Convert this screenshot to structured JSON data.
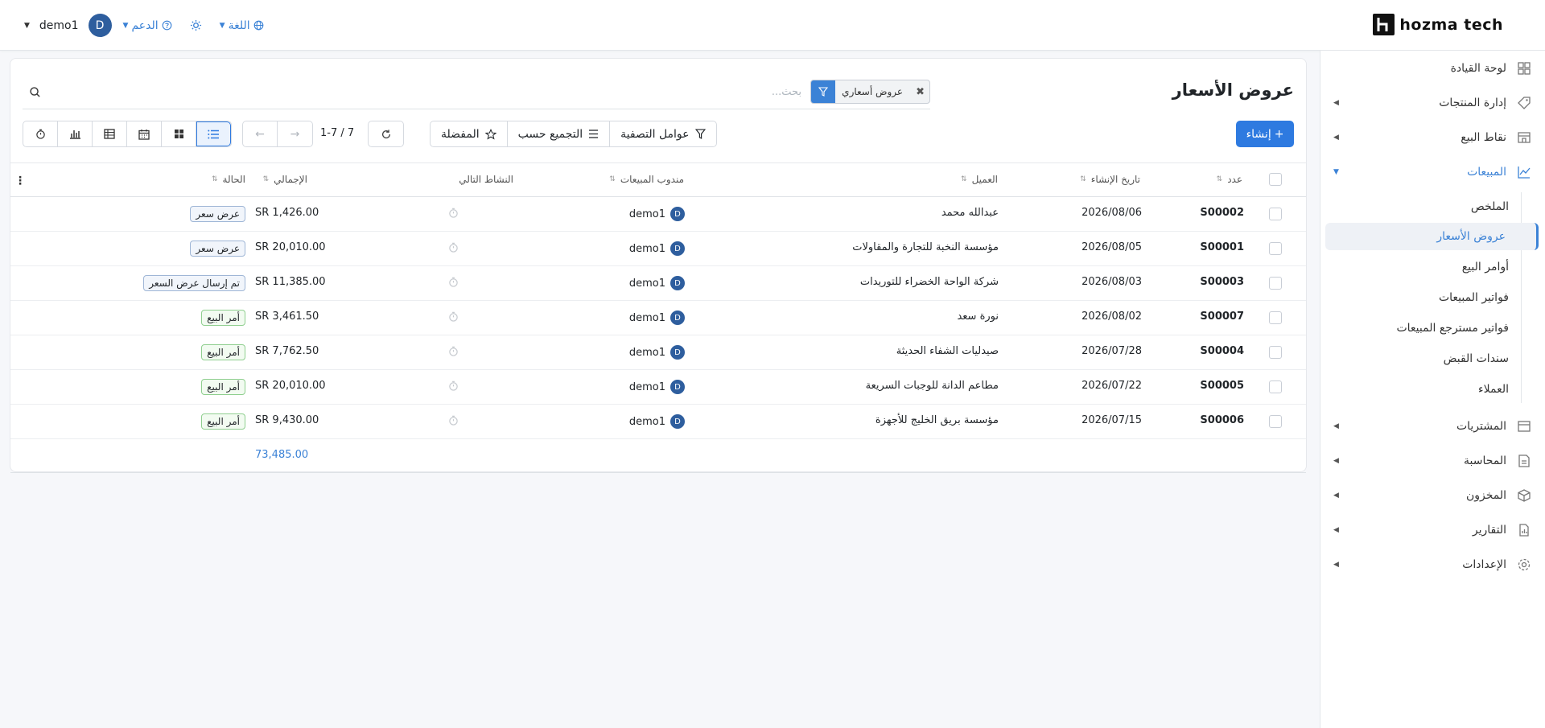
{
  "brand": {
    "logo_text": "hozma tech"
  },
  "topbar": {
    "user_name": "demo1",
    "user_initial": "D",
    "support_label": "الدعم",
    "language_label": "اللغة"
  },
  "sidebar": {
    "items": [
      {
        "label": "لوحة القيادة",
        "icon": "dashboard-icon"
      },
      {
        "label": "إدارة المنتجات",
        "icon": "tag-icon"
      },
      {
        "label": "نقاط البيع",
        "icon": "store-icon"
      },
      {
        "label": "المبيعات",
        "icon": "chart-line-icon"
      },
      {
        "label": "المشتريات",
        "icon": "purchase-icon"
      },
      {
        "label": "المحاسبة",
        "icon": "accounting-icon"
      },
      {
        "label": "المخزون",
        "icon": "box-icon"
      },
      {
        "label": "التقارير",
        "icon": "report-icon"
      },
      {
        "label": "الإعدادات",
        "icon": "gear-icon"
      }
    ],
    "sales_sub": [
      {
        "label": "الملخص"
      },
      {
        "label": "عروض الأسعار"
      },
      {
        "label": "أوامر البيع"
      },
      {
        "label": "فواتير المبيعات"
      },
      {
        "label": "فواتير مسترجع المبيعات"
      },
      {
        "label": "سندات القبض"
      },
      {
        "label": "العملاء"
      }
    ]
  },
  "page": {
    "title": "عروض الأسعار",
    "facet_label": "عروض أسعاري",
    "search_placeholder": "بحث...",
    "create_label": "إنشاء",
    "filters_label": "عوامل التصفية",
    "group_by_label": "التجميع حسب",
    "favorites_label": "المفضلة",
    "pager_text": "1-7 / 7"
  },
  "table": {
    "headers": {
      "number": "عدد",
      "created": "تاريخ الإنشاء",
      "customer": "العميل",
      "salesperson": "مندوب المبيعات",
      "next_activity": "النشاط التالي",
      "total": "الإجمالي",
      "status": "الحالة"
    },
    "rows": [
      {
        "number": "S00002",
        "date": "2026/08/06",
        "customer": "عبدالله محمد",
        "rep": "demo1",
        "rep_initial": "D",
        "total": "SR 1,426.00",
        "status": "عرض سعر",
        "status_type": "quote"
      },
      {
        "number": "S00001",
        "date": "2026/08/05",
        "customer": "مؤسسة النخبة للتجارة والمقاولات",
        "rep": "demo1",
        "rep_initial": "D",
        "total": "SR 20,010.00",
        "status": "عرض سعر",
        "status_type": "quote"
      },
      {
        "number": "S00003",
        "date": "2026/08/03",
        "customer": "شركة الواحة الخضراء للتوريدات",
        "rep": "demo1",
        "rep_initial": "D",
        "total": "SR 11,385.00",
        "status": "تم إرسال عرض السعر",
        "status_type": "sent"
      },
      {
        "number": "S00007",
        "date": "2026/08/02",
        "customer": "نورة سعد",
        "rep": "demo1",
        "rep_initial": "D",
        "total": "SR 3,461.50",
        "status": "أمر البيع",
        "status_type": "order"
      },
      {
        "number": "S00004",
        "date": "2026/07/28",
        "customer": "صيدليات الشفاء الحديثة",
        "rep": "demo1",
        "rep_initial": "D",
        "total": "SR 7,762.50",
        "status": "أمر البيع",
        "status_type": "order"
      },
      {
        "number": "S00005",
        "date": "2026/07/22",
        "customer": "مطاعم الدانة للوجبات السريعة",
        "rep": "demo1",
        "rep_initial": "D",
        "total": "SR 20,010.00",
        "status": "أمر البيع",
        "status_type": "order"
      },
      {
        "number": "S00006",
        "date": "2026/07/15",
        "customer": "مؤسسة بريق الخليج للأجهزة",
        "rep": "demo1",
        "rep_initial": "D",
        "total": "SR 9,430.00",
        "status": "أمر البيع",
        "status_type": "order"
      }
    ],
    "grand_total": "73,485.00"
  },
  "colors": {
    "accent": "#2e7ae0",
    "avatar": "#2e5e9e",
    "order_badge": "#8fcf8f",
    "quote_badge": "#9fb6d6"
  }
}
